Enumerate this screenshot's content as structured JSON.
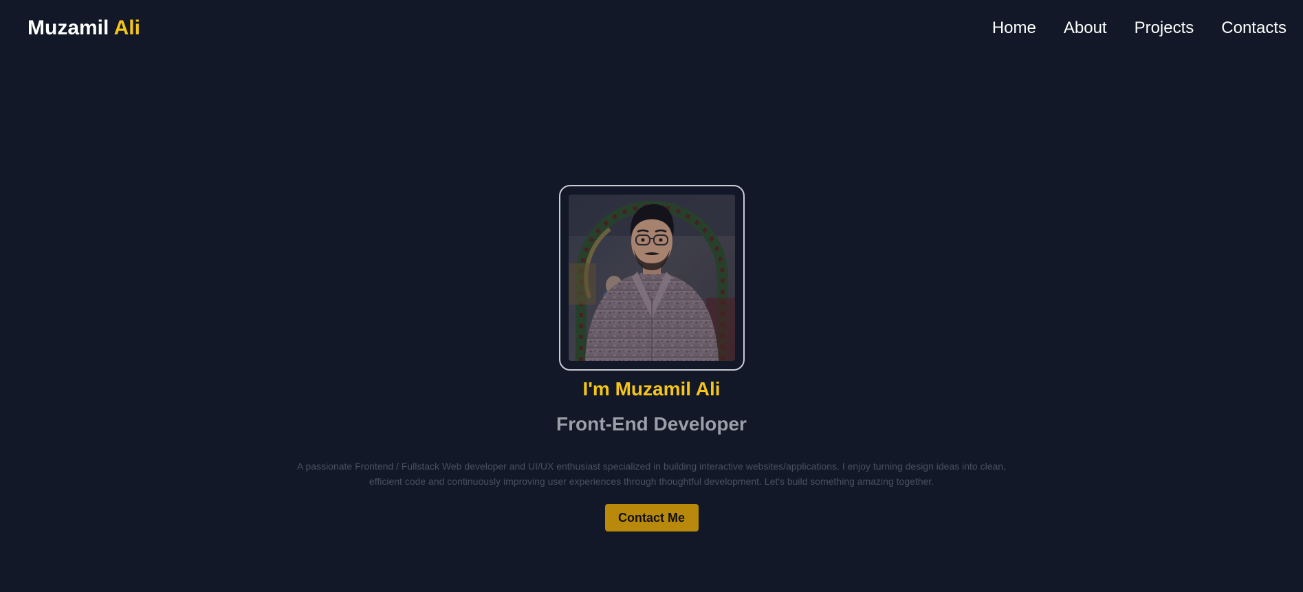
{
  "nav": {
    "logo_first": "Muzamil",
    "logo_accent": "Ali",
    "links": [
      "Home",
      "About",
      "Projects",
      "Contacts"
    ]
  },
  "hero": {
    "greeting": "I'm Muzamil Ali",
    "role": "Front-End Developer",
    "description": "A passionate Frontend / Fullstack Web developer and UI/UX enthusiast specialized in building interactive websites/applications. I enjoy turning design ideas into clean, efficient code and continuously improving user experiences through thoughtful development. Let's build something amazing together.",
    "cta_label": "Contact Me"
  },
  "colors": {
    "background": "#121827",
    "accent": "#f5c518",
    "button": "#b8890a",
    "text": "#ffffff",
    "muted": "#9b9fa8"
  }
}
